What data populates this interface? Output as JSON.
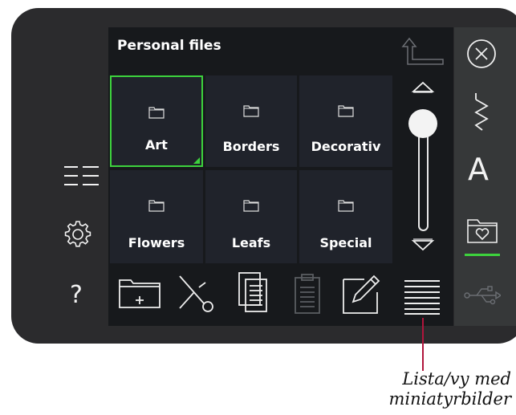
{
  "header": {
    "title": "Personal files"
  },
  "folders": [
    {
      "label": "Art",
      "selected": true
    },
    {
      "label": "Borders",
      "selected": false
    },
    {
      "label": "Decorativ",
      "selected": false
    },
    {
      "label": "Flowers",
      "selected": false
    },
    {
      "label": "Leafs",
      "selected": false
    },
    {
      "label": "Special",
      "selected": false
    }
  ],
  "left_menu": [
    {
      "icon": "list-menu-icon"
    },
    {
      "icon": "gear-icon"
    },
    {
      "icon": "help-icon",
      "text": "?"
    }
  ],
  "right_bar": [
    {
      "icon": "close-icon"
    },
    {
      "icon": "stitch-icon"
    },
    {
      "icon": "font-icon",
      "text": "A"
    },
    {
      "icon": "personal-folder-icon",
      "active": true
    },
    {
      "icon": "usb-icon",
      "disabled": true
    }
  ],
  "toolbar": [
    {
      "icon": "new-folder-icon"
    },
    {
      "icon": "cut-icon"
    },
    {
      "icon": "copy-icon"
    },
    {
      "icon": "paste-icon",
      "disabled": true
    },
    {
      "icon": "rename-icon"
    },
    {
      "icon": "list-view-icon"
    }
  ],
  "callout": {
    "line1": "Lista/vy med",
    "line2": "miniatyrbilder"
  },
  "colors": {
    "accent": "#3dd23d",
    "callout": "#b0153c"
  }
}
